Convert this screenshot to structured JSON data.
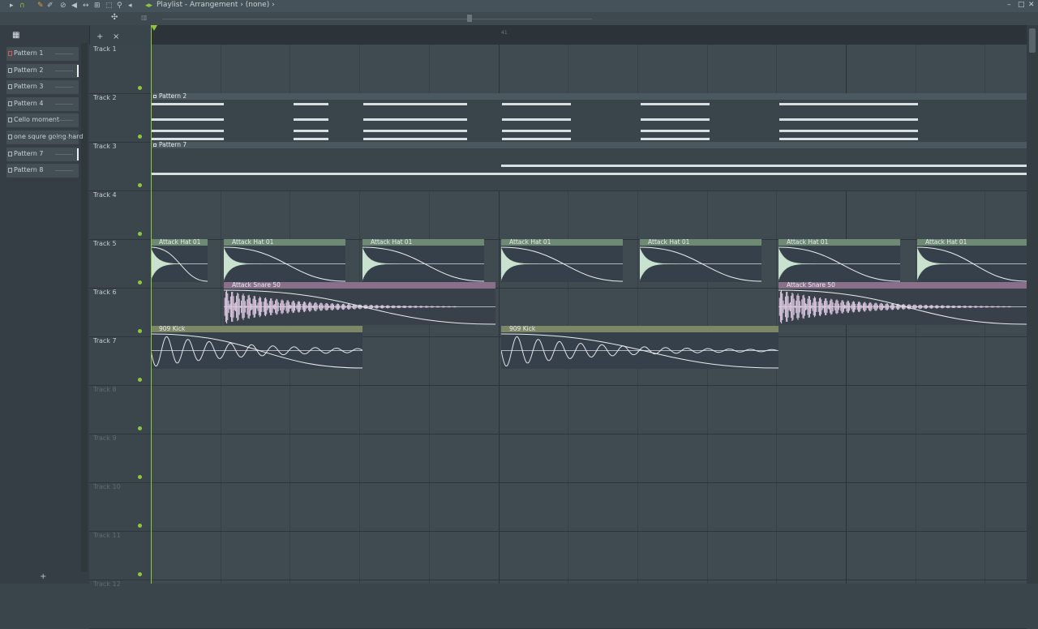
{
  "window": {
    "title": "Playlist - Arrangement",
    "breadcrumb_sep": "›",
    "arrangement": "(none)",
    "trail": "›",
    "minimize": "–",
    "maximize": "□",
    "close": "✕"
  },
  "toolbar": {
    "icons": [
      "play-icon",
      "magnet-icon",
      "pencil-icon",
      "brush-icon",
      "delete-icon",
      "mute-icon",
      "slip-icon",
      "select-icon",
      "slice-icon",
      "zoom-icon",
      "speaker-icon"
    ]
  },
  "picker": {
    "piano_icon": "▦",
    "add": "+",
    "close": "×",
    "new_pattern": "+",
    "items": [
      {
        "label": "Pattern 1",
        "selected": true
      },
      {
        "label": "Pattern 2",
        "marker": true
      },
      {
        "label": "Pattern 3"
      },
      {
        "label": "Pattern 4"
      },
      {
        "label": "Cello moment"
      },
      {
        "label": "one squre going hard"
      },
      {
        "label": "Pattern 7",
        "marker": true
      },
      {
        "label": "Pattern 8"
      }
    ]
  },
  "ruler": {
    "bar_label": "41"
  },
  "tracks": [
    {
      "label": "Track 1"
    },
    {
      "label": "Track 2"
    },
    {
      "label": "Track 3"
    },
    {
      "label": "Track 4"
    },
    {
      "label": "Track 5"
    },
    {
      "label": "Track 6"
    },
    {
      "label": "Track 7"
    },
    {
      "label": "Track 8"
    },
    {
      "label": "Track 9"
    },
    {
      "label": "Track 10"
    },
    {
      "label": "Track 11"
    },
    {
      "label": "Track 12"
    }
  ],
  "clips": {
    "pattern2": "Pattern 2",
    "pattern7": "Pattern 7",
    "hat": "Attack Hat 01",
    "snare": "Attack Snare 50",
    "kick": "909 Kick"
  },
  "colors": {
    "accent": "#8ec63f",
    "hat_header": "#6e8a73",
    "snare_header": "#8a6f8a",
    "kick_header": "#7c8766"
  }
}
